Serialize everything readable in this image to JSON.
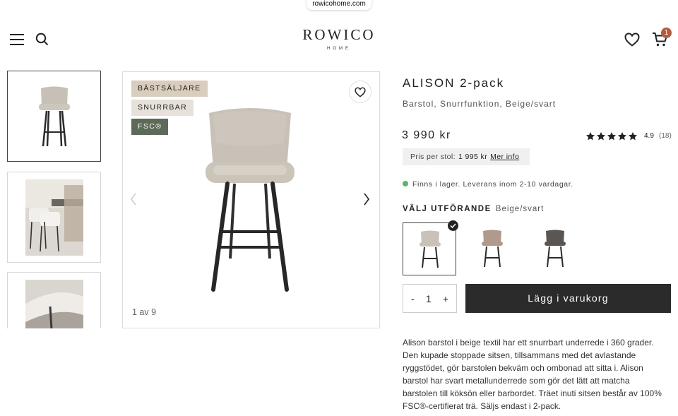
{
  "browser": {
    "url": "rowicohome.com"
  },
  "header": {
    "logo": "ROWICO",
    "logo_sub": "HOME",
    "cart_count": "1",
    "cart_badge_color": "#b5593f"
  },
  "gallery": {
    "badges": [
      {
        "label": "BÄSTSÄLJARE",
        "bg": "#d9cdbd",
        "color": "#222222"
      },
      {
        "label": "SNURRBAR",
        "bg": "#e6e2da",
        "color": "#222222"
      },
      {
        "label": "FSC®",
        "bg": "#5d6a59",
        "color": "#ffffff"
      }
    ],
    "counter": "1 av 9",
    "icons": [
      "heart-icon",
      "chevron-left-icon",
      "chevron-right-icon"
    ]
  },
  "product": {
    "title": "ALISON  2-pack",
    "subtitle": "Barstol, Snurrfunktion, Beige/svart",
    "price": "3 990 kr",
    "rating": {
      "stars": 5,
      "value": "4.9",
      "count": "(18)"
    },
    "unit_price": {
      "label": "Pris per stol:",
      "value": "1 995 kr",
      "link": "Mer info"
    },
    "stock": {
      "text": "Finns i lager. Leverans inom 2-10 vardagar.",
      "color": "#5fb26b"
    },
    "variant": {
      "label": "VÄLJ UTFÖRANDE",
      "value": "Beige/svart",
      "swatches": [
        {
          "name": "Beige/svart",
          "selected": true,
          "color": "#c9c2b8"
        },
        {
          "name": "Brun",
          "selected": false,
          "color": "#b09a8c"
        },
        {
          "name": "Mörkgrå",
          "selected": false,
          "color": "#5b5651"
        }
      ]
    },
    "quantity": {
      "minus": "-",
      "value": "1",
      "plus": "+"
    },
    "add_to_cart": "Lägg i varukorg",
    "description": "Alison barstol i beige textil har ett snurrbart underrede i 360 grader. Den kupade stoppade sitsen, tillsammans med det avlastande ryggstödet, gör barstolen bekväm och ombonad att sitta i. Alison barstol har svart metallunderrede som gör det lätt att matcha barstolen till köksön eller barbordet. Träet inuti sitsen består av 100% FSC®-certifierat trä. Säljs endast i 2-pack."
  }
}
